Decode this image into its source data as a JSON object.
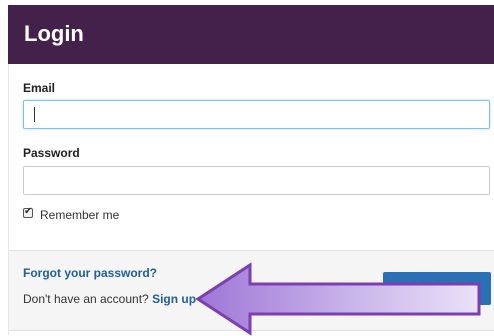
{
  "header": {
    "title": "Login"
  },
  "form": {
    "email_label": "Email",
    "email_value": "",
    "password_label": "Password",
    "password_value": "",
    "remember_label": "Remember me",
    "remember_checked": true
  },
  "footer": {
    "forgot_password_link": "Forgot your password?",
    "signup_prompt": "Don't have an account?",
    "signup_link": "Sign up"
  },
  "colors": {
    "header_bg": "#44214a",
    "link": "#1f5ea0",
    "submit_button": "#2b6fb5",
    "focus_border": "#7cc2ec",
    "annotation_arrow_fill": "#c8b6e6",
    "annotation_arrow_stroke": "#7b3fb0"
  },
  "annotation": {
    "type": "arrow",
    "direction": "left",
    "points_to": "signup_link"
  }
}
